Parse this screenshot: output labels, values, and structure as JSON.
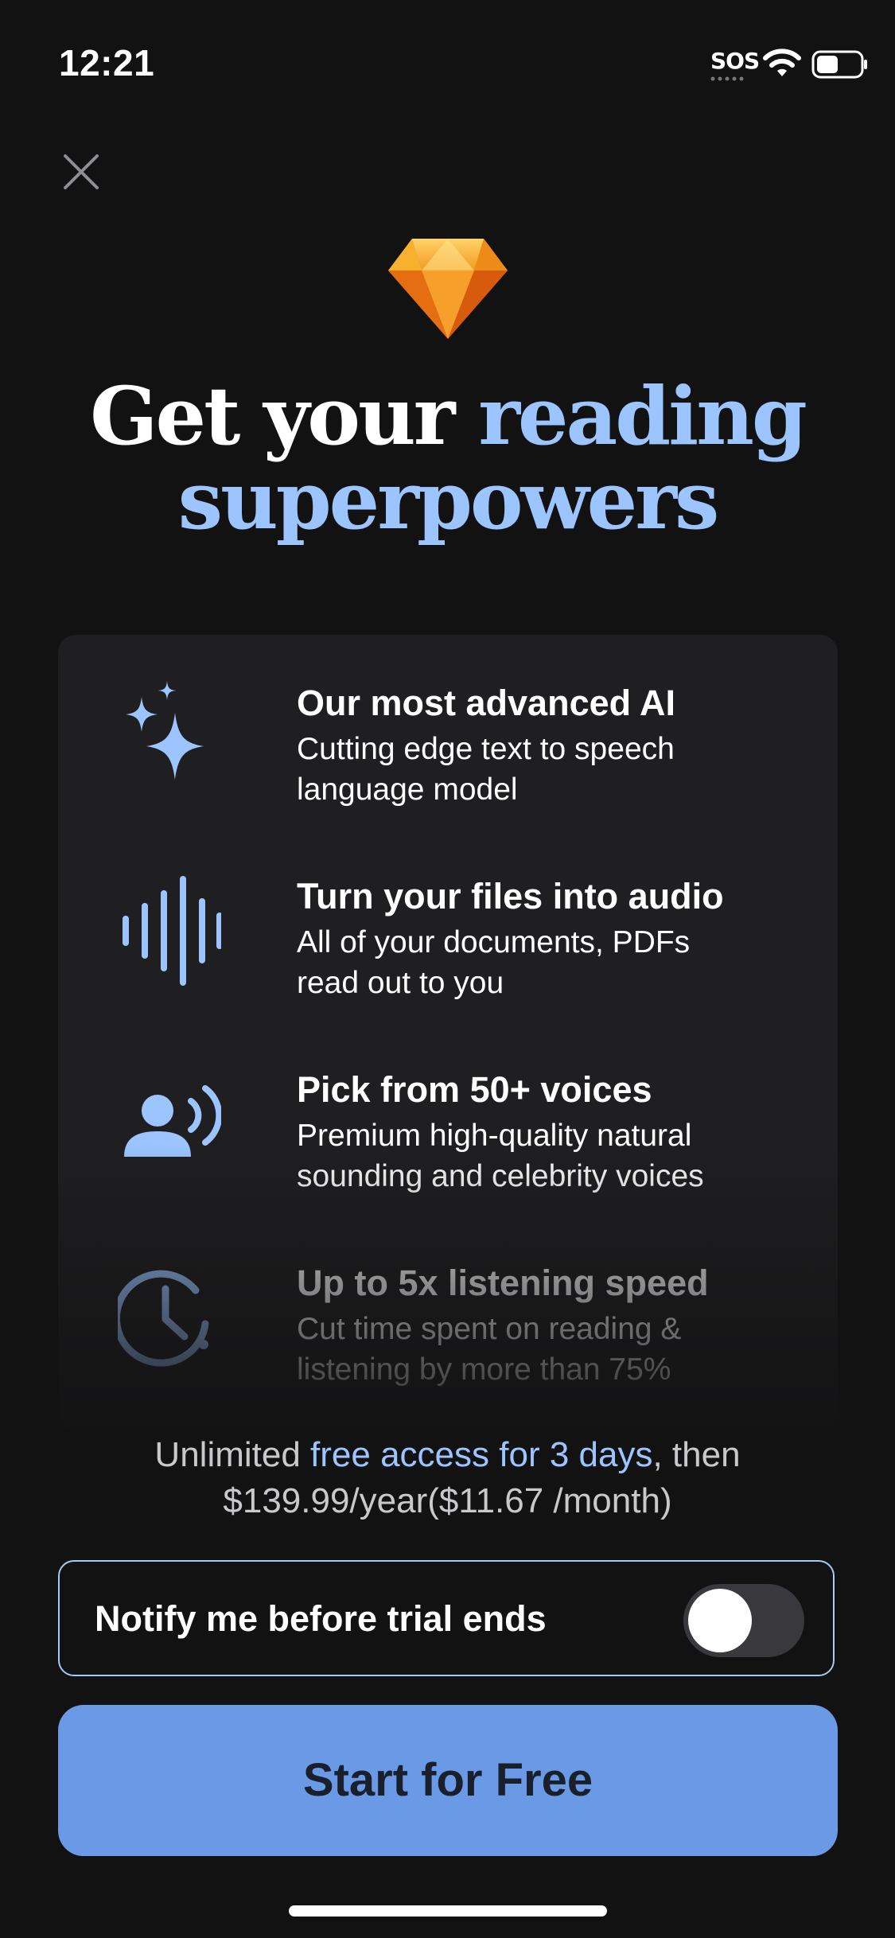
{
  "status_bar": {
    "time": "12:21",
    "carrier": "SOS",
    "wifi_icon": "wifi-icon",
    "battery_icon": "battery-icon",
    "battery_level": 0.5
  },
  "icons": {
    "close": "close-icon",
    "gem": "gem-icon"
  },
  "headline": {
    "part1": "Get your ",
    "part2": "reading",
    "part3": "superpowers",
    "accent_color": "#9cc5ff"
  },
  "features": [
    {
      "icon": "sparkles-icon",
      "title": "Our most advanced AI",
      "desc_line1": "Cutting edge text to speech",
      "desc_line2": "language model"
    },
    {
      "icon": "audio-waveform-icon",
      "title": "Turn your files into audio",
      "desc_line1": "All of your documents, PDFs",
      "desc_line2": "read out to you"
    },
    {
      "icon": "person-speaking-icon",
      "title": "Pick from 50+ voices",
      "desc_line1": "Premium high-quality natural",
      "desc_line2": "sounding and celebrity voices"
    },
    {
      "icon": "clock-speed-icon",
      "title": "Up to 5x listening speed",
      "desc_line1": "Cut time spent on reading &",
      "desc_line2": "listening by more than 75%"
    }
  ],
  "offer": {
    "prefix": "Unlimited ",
    "highlight": "free access for 3 days",
    "suffix": ", then",
    "price_line": "$139.99/year($11.67 /month)"
  },
  "notify": {
    "label": "Notify me before trial ends",
    "toggle_on": false
  },
  "cta": {
    "label": "Start for Free",
    "color": "#6a99e5"
  }
}
